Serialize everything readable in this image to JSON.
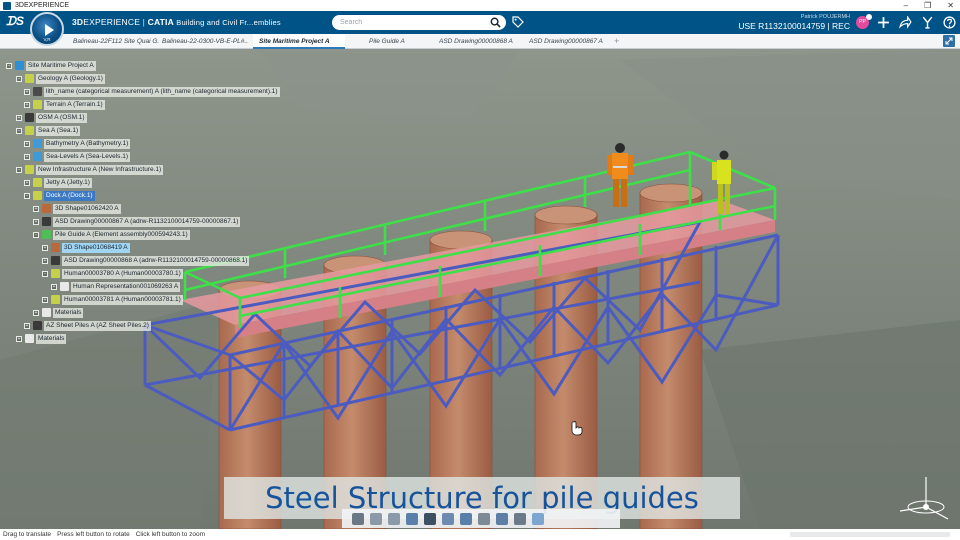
{
  "window": {
    "title": "3DEXPERIENCE",
    "controls": [
      "–",
      "❐",
      "✕"
    ]
  },
  "header": {
    "brand_3d": "3D",
    "brand_experience": "EXPERIENCE",
    "brand_sep": " | ",
    "brand_app": "CATIA",
    "brand_context": " Building and Civil Fr...emblies",
    "compass_label": "V,R",
    "search_placeholder": "Search",
    "user_name": "Patrick POUJERMH",
    "user_context": "USE R1132100014759 | REC",
    "avatar_initials": "PP",
    "icons": [
      "search-icon",
      "tag-icon",
      "add-icon",
      "share-icon",
      "tools-icon",
      "help-icon"
    ]
  },
  "tabs": [
    {
      "label": "Balineau-22F112 Site Quai G...",
      "active": false
    },
    {
      "label": "Balineau-22-0300-VB-E-PL#...",
      "active": false
    },
    {
      "label": "Site Maritime Project A",
      "active": true
    },
    {
      "label": "Pile Guide A",
      "active": false
    },
    {
      "label": "ASD Drawing00000868 A",
      "active": false
    },
    {
      "label": "ASD Drawing00000867 A",
      "active": false
    }
  ],
  "tree": [
    {
      "label": "Site Maritime Project A",
      "toggle": "−",
      "state": ""
    },
    {
      "label": "Geology A (Geology.1)",
      "toggle": "−",
      "state": ""
    },
    {
      "label": "lith_name (categorical measurement) A (lith_name (categorical measurement).1)",
      "toggle": "+",
      "state": ""
    },
    {
      "label": "Terrain A (Terrain.1)",
      "toggle": "+",
      "state": ""
    },
    {
      "label": "OSM A (OSM.1)",
      "toggle": "+",
      "state": ""
    },
    {
      "label": "Sea A (Sea.1)",
      "toggle": "−",
      "state": ""
    },
    {
      "label": "Bathymetry A (Bathymetry.1)",
      "toggle": "+",
      "state": ""
    },
    {
      "label": "Sea-Levels A (Sea-Levels.1)",
      "toggle": "+",
      "state": ""
    },
    {
      "label": "New Infrastructure A (New Infrastructure.1)",
      "toggle": "−",
      "state": ""
    },
    {
      "label": "Jetty A (Jetty.1)",
      "toggle": "+",
      "state": ""
    },
    {
      "label": "Dock A (Dock.1)",
      "toggle": "−",
      "state": "selected"
    },
    {
      "label": "3D Shape01062420 A",
      "toggle": "+",
      "state": ""
    },
    {
      "label": "ASD Drawing00000867 A (adrw-R1132100014759-00000867.1)",
      "toggle": "+",
      "state": ""
    },
    {
      "label": "Pile Guide A (Element assembly000594243.1)",
      "toggle": "−",
      "state": ""
    },
    {
      "label": "3D Shape01068419 A",
      "toggle": "+",
      "state": "highlight"
    },
    {
      "label": "ASD Drawing00000868 A (adrw-R1132100014759-00000868.1)",
      "toggle": "+",
      "state": ""
    },
    {
      "label": "Human00003780 A (Human00003780.1)",
      "toggle": "−",
      "state": ""
    },
    {
      "label": "Human Representation001069263 A",
      "toggle": "+",
      "state": ""
    },
    {
      "label": "Human00003781 A (Human00003781.1)",
      "toggle": "+",
      "state": ""
    },
    {
      "label": "Materials",
      "toggle": "+",
      "state": ""
    },
    {
      "label": "AZ Sheet Piles A (AZ Sheet Piles.2)",
      "toggle": "+",
      "state": ""
    },
    {
      "label": "Materials",
      "toggle": "+",
      "state": ""
    }
  ],
  "caption": "Steel Structure for pile guides",
  "statusbar": {
    "items": [
      "Drag to translate",
      "Press left button to rotate",
      "Click left button to zoom"
    ]
  },
  "colors": {
    "brand_blue": "#005386",
    "selection": "#3b79c4",
    "caption_text": "#16539b",
    "pile": "#b4785a",
    "steel_frame": "#4c5bc0",
    "handrail": "#3fdf4a",
    "deck": "#e79aa0"
  }
}
